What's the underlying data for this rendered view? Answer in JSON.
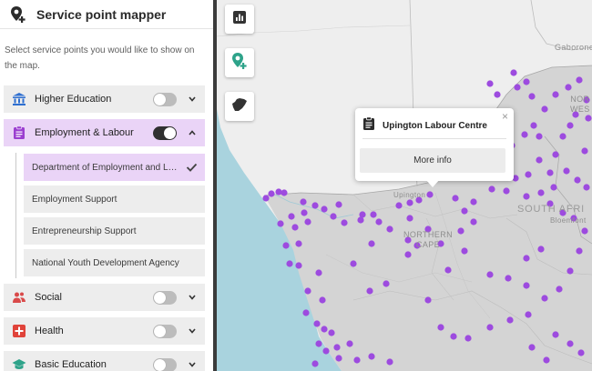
{
  "app": {
    "title": "Service point mapper",
    "logo_icon": "map-pin-plus-icon"
  },
  "sidebar": {
    "intro": "Select service points you would like to show on the map.",
    "categories": [
      {
        "label": "Higher Education",
        "icon": "institution-icon",
        "color": "#2f6fd0",
        "toggle_on": false,
        "expanded": false
      },
      {
        "label": "Employment & Labour",
        "icon": "clipboard-icon",
        "color": "#9b3fd0",
        "toggle_on": true,
        "expanded": true
      },
      {
        "label": "Social",
        "icon": "people-icon",
        "color": "#d94a4a",
        "toggle_on": false,
        "expanded": false
      },
      {
        "label": "Health",
        "icon": "health-plus-icon",
        "color": "#e0433a",
        "toggle_on": false,
        "expanded": false
      },
      {
        "label": "Basic Education",
        "icon": "graduation-cap-icon",
        "color": "#2ea38a",
        "toggle_on": false,
        "expanded": false
      }
    ],
    "employment_subcategories": [
      {
        "label": "Department of Employment and Labour",
        "selected": true
      },
      {
        "label": "Employment Support",
        "selected": false
      },
      {
        "label": "Entrepreneurship Support",
        "selected": false
      },
      {
        "label": "National Youth Development Agency",
        "selected": false
      }
    ]
  },
  "map": {
    "labels": {
      "gaborone": "Gaborone",
      "nw_line1": "NOR",
      "nw_line2": "WES",
      "south_africa": "SOUTH AFRI",
      "bloemfontein": "Bloemfont",
      "upington": "Upington",
      "northern_cape_line1": "NORTHERN",
      "northern_cape_line2": "CAPE"
    },
    "tools": [
      {
        "icon": "bar-chart-icon"
      },
      {
        "icon": "add-location-icon"
      },
      {
        "icon": "africa-region-icon"
      }
    ],
    "colors": {
      "marker": "#9d4bdf",
      "land": "#eeeeee",
      "highlight_land": "#d4d4d4",
      "water": "#a9d3de",
      "accent": "#ead4f7"
    },
    "popup": {
      "icon": "clipboard-icon",
      "title": "Upington Labour Centre",
      "button": "More info",
      "close": "×"
    }
  }
}
